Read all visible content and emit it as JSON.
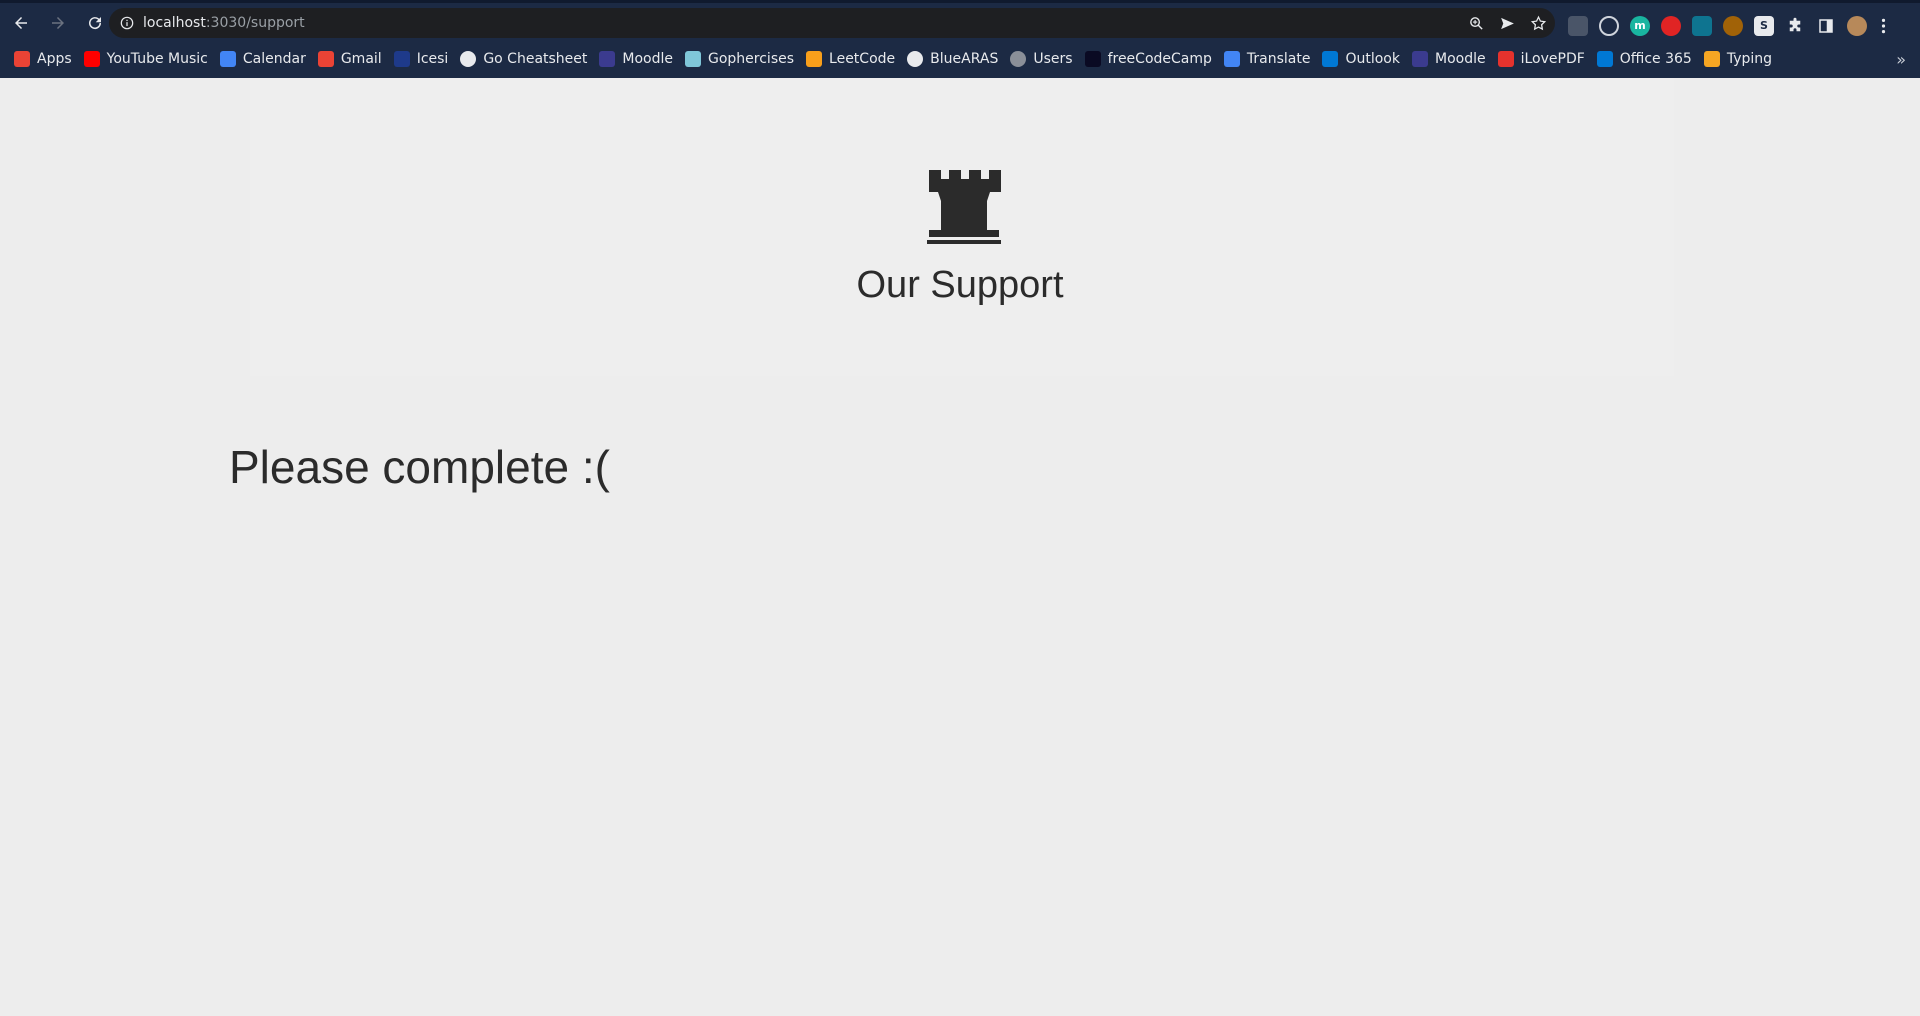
{
  "browser": {
    "url_host": "localhost",
    "url_path": ":3030/support"
  },
  "bookmarks": [
    {
      "label": "Apps",
      "icon": "apps-grid-icon",
      "color": "#ea4335"
    },
    {
      "label": "YouTube Music",
      "icon": "youtube-music-icon",
      "color": "#ff0000"
    },
    {
      "label": "Calendar",
      "icon": "calendar-icon",
      "color": "#4285f4"
    },
    {
      "label": "Gmail",
      "icon": "gmail-icon",
      "color": "#ea4335"
    },
    {
      "label": "Icesi",
      "icon": "icesi-icon",
      "color": "#1e3a8a"
    },
    {
      "label": "Go Cheatsheet",
      "icon": "github-icon",
      "color": "#e8eaed"
    },
    {
      "label": "Moodle",
      "icon": "moodle-icon",
      "color": "#3b3b8f"
    },
    {
      "label": "Gophercises",
      "icon": "gophercises-icon",
      "color": "#7fc7d9"
    },
    {
      "label": "LeetCode",
      "icon": "leetcode-icon",
      "color": "#f89f1b"
    },
    {
      "label": "BlueARAS",
      "icon": "bluearas-icon",
      "color": "#e8eaed"
    },
    {
      "label": "Users",
      "icon": "globe-icon",
      "color": "#8a8f98"
    },
    {
      "label": "freeCodeCamp",
      "icon": "freecodecamp-icon",
      "color": "#0a0a23"
    },
    {
      "label": "Translate",
      "icon": "translate-icon",
      "color": "#4285f4"
    },
    {
      "label": "Outlook",
      "icon": "outlook-icon",
      "color": "#0078d4"
    },
    {
      "label": "Moodle",
      "icon": "moodle-icon",
      "color": "#3b3b8f"
    },
    {
      "label": "iLovePDF",
      "icon": "ilovepdf-icon",
      "color": "#e5322d"
    },
    {
      "label": "Office 365",
      "icon": "office365-icon",
      "color": "#0078d4"
    },
    {
      "label": "Typing",
      "icon": "typing-icon",
      "color": "#f5a623"
    }
  ],
  "page": {
    "hero_icon": "chess-rook-icon",
    "hero_title": "Our Support",
    "message": "Please complete :("
  },
  "colors": {
    "chrome_bg": "#1c2a44",
    "omnibox_bg": "#1e1f22",
    "page_bg": "#ededed",
    "text": "#2b2b2b"
  }
}
